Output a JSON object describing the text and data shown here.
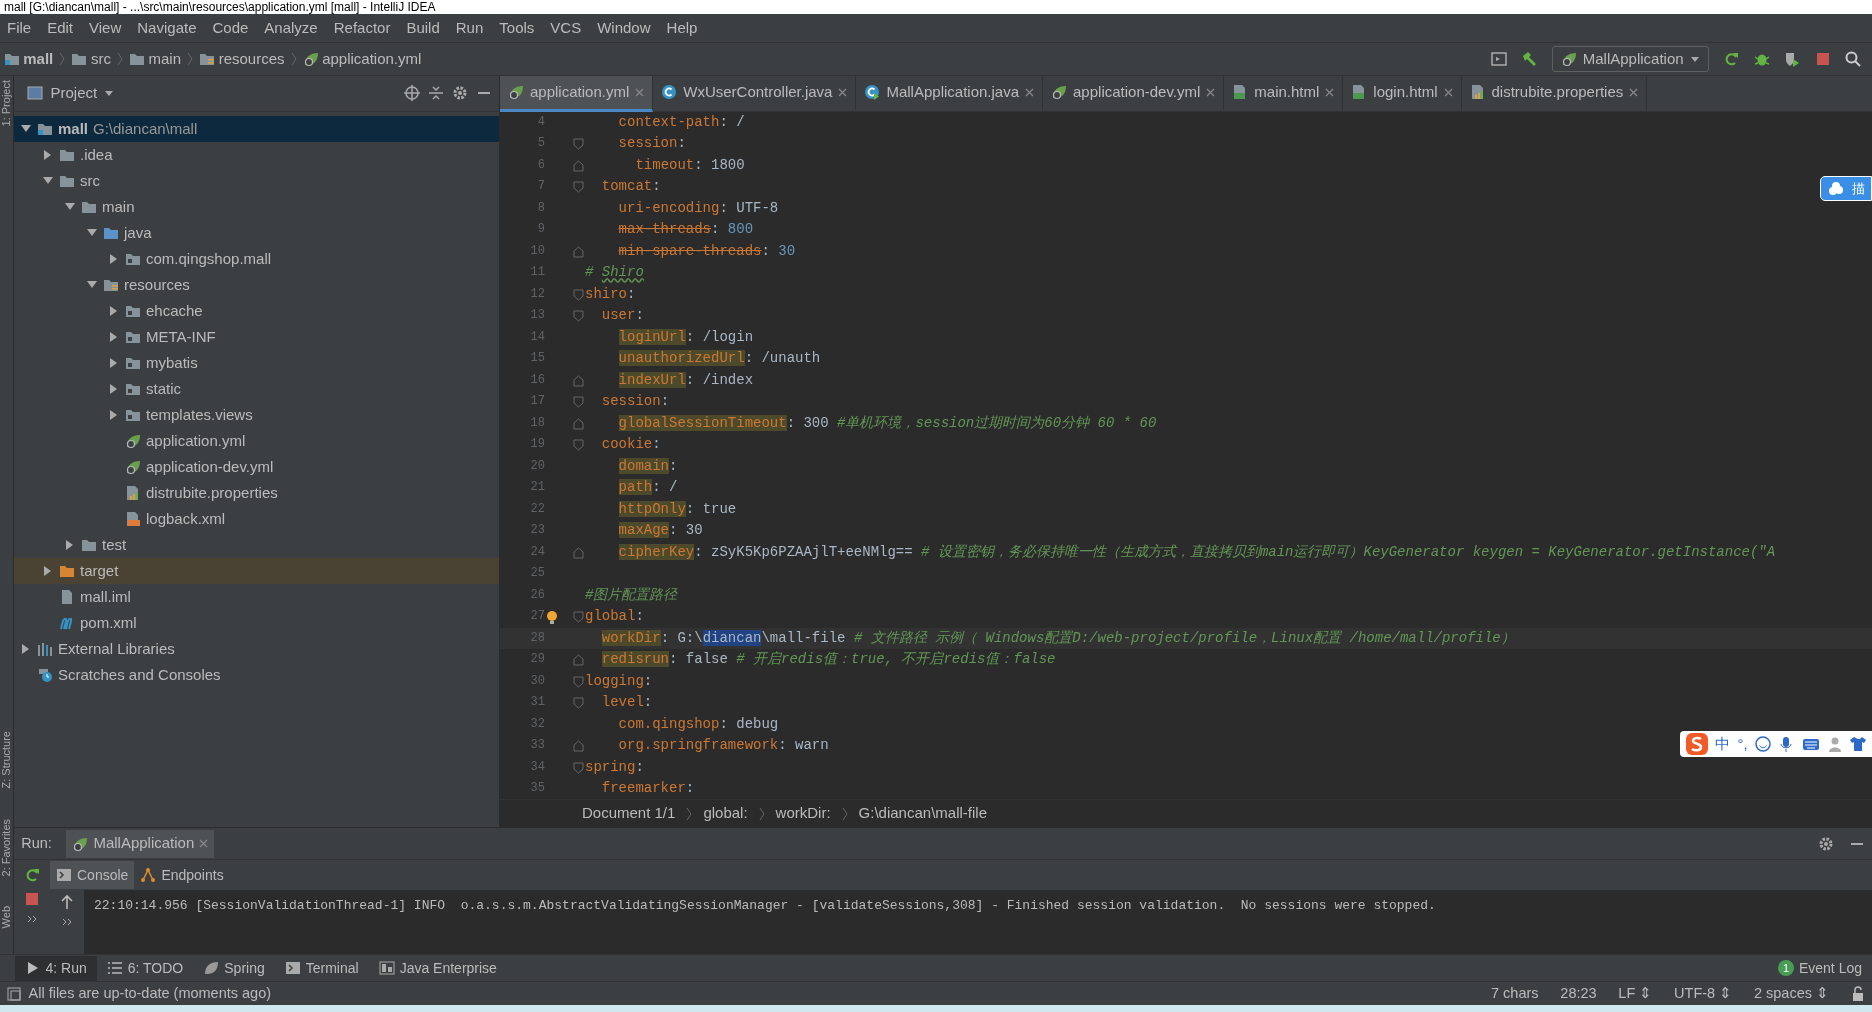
{
  "window": {
    "title": "mall [G:\\diancan\\mall] - ...\\src\\main\\resources\\application.yml [mall] - IntelliJ IDEA"
  },
  "menu": [
    "File",
    "Edit",
    "View",
    "Navigate",
    "Code",
    "Analyze",
    "Refactor",
    "Build",
    "Run",
    "Tools",
    "VCS",
    "Window",
    "Help"
  ],
  "nav_path": [
    {
      "label": "mall",
      "kind": "module"
    },
    {
      "label": "src",
      "kind": "folder"
    },
    {
      "label": "main",
      "kind": "folder"
    },
    {
      "label": "resources",
      "kind": "resources"
    },
    {
      "label": "application.yml",
      "kind": "spring"
    }
  ],
  "run_config": {
    "label": "MallApplication"
  },
  "side_strip": [
    "1: Project",
    "Z: Structure",
    "2: Favorites",
    "Web"
  ],
  "project_panel": {
    "title": "Project"
  },
  "tree": [
    {
      "name": "mall",
      "path": "G:\\diancan\\mall",
      "kind": "module",
      "expanded": true,
      "selected": true,
      "children": [
        {
          "name": ".idea",
          "kind": "folder",
          "expanded": false,
          "selected": false
        },
        {
          "name": "src",
          "kind": "folder",
          "expanded": true,
          "selected": false,
          "children": [
            {
              "name": "main",
              "kind": "folder",
              "expanded": true,
              "selected": false,
              "children": [
                {
                  "name": "java",
                  "kind": "source",
                  "expanded": true,
                  "selected": false,
                  "children": [
                    {
                      "name": "com.qingshop.mall",
                      "kind": "package",
                      "expanded": false,
                      "selected": false
                    }
                  ]
                },
                {
                  "name": "resources",
                  "kind": "resources",
                  "expanded": true,
                  "selected": false,
                  "children": [
                    {
                      "name": "ehcache",
                      "kind": "package",
                      "expanded": false,
                      "selected": false
                    },
                    {
                      "name": "META-INF",
                      "kind": "package",
                      "expanded": false,
                      "selected": false
                    },
                    {
                      "name": "mybatis",
                      "kind": "package",
                      "expanded": false,
                      "selected": false
                    },
                    {
                      "name": "static",
                      "kind": "package",
                      "expanded": false,
                      "selected": false
                    },
                    {
                      "name": "templates.views",
                      "kind": "package",
                      "expanded": false,
                      "selected": false
                    },
                    {
                      "name": "application.yml",
                      "kind": "spring",
                      "selected": false
                    },
                    {
                      "name": "application-dev.yml",
                      "kind": "spring",
                      "selected": false
                    },
                    {
                      "name": "distrubite.properties",
                      "kind": "props",
                      "selected": false
                    },
                    {
                      "name": "logback.xml",
                      "kind": "xml",
                      "selected": false
                    }
                  ]
                }
              ]
            },
            {
              "name": "test",
              "kind": "folder",
              "expanded": false,
              "selected": false
            }
          ]
        },
        {
          "name": "target",
          "kind": "excluded",
          "expanded": false,
          "selected": false
        },
        {
          "name": "mall.iml",
          "kind": "iml",
          "selected": false
        },
        {
          "name": "pom.xml",
          "kind": "maven",
          "selected": false
        }
      ]
    },
    {
      "name": "External Libraries",
      "kind": "library",
      "expanded": false,
      "selected": false
    },
    {
      "name": "Scratches and Consoles",
      "kind": "scratches",
      "selected": false
    }
  ],
  "editor_tabs": [
    {
      "label": "application.yml",
      "kind": "spring",
      "selected": true
    },
    {
      "label": "WxUserController.java",
      "kind": "class",
      "selected": false
    },
    {
      "label": "MallApplication.java",
      "kind": "runclass",
      "selected": false
    },
    {
      "label": "application-dev.yml",
      "kind": "spring",
      "selected": false
    },
    {
      "label": "main.html",
      "kind": "html",
      "selected": false
    },
    {
      "label": "login.html",
      "kind": "html",
      "selected": false
    },
    {
      "label": "distrubite.properties",
      "kind": "props",
      "selected": false
    }
  ],
  "code_lines": [
    {
      "number": "4",
      "kind": "plain",
      "tokens": [
        {
          "kind": "key",
          "text": "    context-path"
        },
        {
          "kind": "plain",
          "text": ": /"
        }
      ]
    },
    {
      "number": "5",
      "kind": "fold_start",
      "tokens": [
        {
          "kind": "key",
          "text": "    session"
        },
        {
          "kind": "plain",
          "text": ":"
        }
      ]
    },
    {
      "number": "6",
      "kind": "fold_end",
      "tokens": [
        {
          "kind": "key",
          "text": "      timeout"
        },
        {
          "kind": "plain",
          "text": ": 1800"
        }
      ]
    },
    {
      "number": "7",
      "kind": "fold_start",
      "tokens": [
        {
          "kind": "key",
          "text": "  tomcat"
        },
        {
          "kind": "plain",
          "text": ":"
        }
      ]
    },
    {
      "number": "8",
      "kind": "plain",
      "tokens": [
        {
          "kind": "key",
          "text": "    uri-encoding"
        },
        {
          "kind": "plain",
          "text": ": UTF-8"
        }
      ]
    },
    {
      "number": "9",
      "kind": "plain",
      "tokens": [
        {
          "kind": "strike",
          "text": "    max-threads"
        },
        {
          "kind": "plain",
          "text": ": "
        },
        {
          "kind": "num",
          "text": "800"
        }
      ]
    },
    {
      "number": "10",
      "kind": "fold_end",
      "tokens": [
        {
          "kind": "strike",
          "text": "    min-spare-threads"
        },
        {
          "kind": "plain",
          "text": ": "
        },
        {
          "kind": "num",
          "text": "30"
        }
      ]
    },
    {
      "number": "11",
      "kind": "plain",
      "tokens": [
        {
          "kind": "comment",
          "text": "# "
        },
        {
          "kind": "typo",
          "text": "Shiro"
        }
      ]
    },
    {
      "number": "12",
      "kind": "fold_start",
      "tokens": [
        {
          "kind": "key",
          "text": "shiro"
        },
        {
          "kind": "plain",
          "text": ":"
        }
      ]
    },
    {
      "number": "13",
      "kind": "fold_start",
      "tokens": [
        {
          "kind": "key",
          "text": "  user"
        },
        {
          "kind": "plain",
          "text": ":"
        }
      ]
    },
    {
      "number": "14",
      "kind": "plain",
      "tokens": [
        {
          "kind": "keyhl",
          "text": "    loginUrl"
        },
        {
          "kind": "plain",
          "text": ": /login"
        }
      ]
    },
    {
      "number": "15",
      "kind": "plain",
      "tokens": [
        {
          "kind": "keyhl",
          "text": "    unauthorizedUrl"
        },
        {
          "kind": "plain",
          "text": ": /unauth"
        }
      ]
    },
    {
      "number": "16",
      "kind": "fold_end",
      "tokens": [
        {
          "kind": "keyhl",
          "text": "    indexUrl"
        },
        {
          "kind": "plain",
          "text": ": /index"
        }
      ]
    },
    {
      "number": "17",
      "kind": "fold_start",
      "tokens": [
        {
          "kind": "key",
          "text": "  session"
        },
        {
          "kind": "plain",
          "text": ":"
        }
      ]
    },
    {
      "number": "18",
      "kind": "fold_end",
      "tokens": [
        {
          "kind": "keyhl",
          "text": "    globalSessionTimeout"
        },
        {
          "kind": "plain",
          "text": ": 300 "
        },
        {
          "kind": "comment",
          "text": "#单机环境，session过期时间为60分钟 60 * 60"
        }
      ]
    },
    {
      "number": "19",
      "kind": "fold_start",
      "tokens": [
        {
          "kind": "key",
          "text": "  cookie"
        },
        {
          "kind": "plain",
          "text": ":"
        }
      ]
    },
    {
      "number": "20",
      "kind": "plain",
      "tokens": [
        {
          "kind": "keyhl",
          "text": "    domain"
        },
        {
          "kind": "plain",
          "text": ":"
        }
      ]
    },
    {
      "number": "21",
      "kind": "plain",
      "tokens": [
        {
          "kind": "keyhl",
          "text": "    path"
        },
        {
          "kind": "plain",
          "text": ": /"
        }
      ]
    },
    {
      "number": "22",
      "kind": "plain",
      "tokens": [
        {
          "kind": "keyhl",
          "text": "    httpOnly"
        },
        {
          "kind": "plain",
          "text": ": true"
        }
      ]
    },
    {
      "number": "23",
      "kind": "plain",
      "tokens": [
        {
          "kind": "keyhl",
          "text": "    maxAge"
        },
        {
          "kind": "plain",
          "text": ": 30"
        }
      ]
    },
    {
      "number": "24",
      "kind": "fold_end",
      "tokens": [
        {
          "kind": "keyhl",
          "text": "    cipherKey"
        },
        {
          "kind": "plain",
          "text": ": zSyK5Kp6PZAAjlT+eeNMlg== "
        },
        {
          "kind": "comment",
          "text": "# 设置密钥，务必保持唯一性（生成方式，直接拷贝到main运行即可）KeyGenerator keygen = KeyGenerator.getInstance(\"A"
        }
      ]
    },
    {
      "number": "25",
      "kind": "plain"
    },
    {
      "number": "26",
      "kind": "plain",
      "tokens": [
        {
          "kind": "comment",
          "text": "#图片配置路径"
        }
      ]
    },
    {
      "number": "27",
      "kind": "fold_start",
      "bulb": true,
      "tokens": [
        {
          "kind": "key",
          "text": "global"
        },
        {
          "kind": "plain",
          "text": ":"
        }
      ]
    },
    {
      "number": "28",
      "kind": "plain",
      "current": true,
      "tokens": [
        {
          "kind": "keyhl",
          "text": "  workDir"
        },
        {
          "kind": "plain",
          "text": ": G:\\"
        },
        {
          "kind": "sel",
          "text": "diancan"
        },
        {
          "kind": "plain",
          "text": "\\mall-file "
        },
        {
          "kind": "comment",
          "text": "# 文件路径 示例（ Windows配置D:/web-project/profile，Linux配置 /home/mall/profile）"
        }
      ]
    },
    {
      "number": "29",
      "kind": "fold_end",
      "tokens": [
        {
          "kind": "keyhl",
          "text": "  redisrun"
        },
        {
          "kind": "plain",
          "text": ": false "
        },
        {
          "kind": "comment",
          "text": "# 开启redis值：true, 不开启redis值：false"
        }
      ]
    },
    {
      "number": "30",
      "kind": "fold_start",
      "tokens": [
        {
          "kind": "key",
          "text": "logging"
        },
        {
          "kind": "plain",
          "text": ":"
        }
      ]
    },
    {
      "number": "31",
      "kind": "fold_start",
      "tokens": [
        {
          "kind": "key",
          "text": "  level"
        },
        {
          "kind": "plain",
          "text": ":"
        }
      ]
    },
    {
      "number": "32",
      "kind": "plain",
      "tokens": [
        {
          "kind": "key",
          "text": "    com.qingshop"
        },
        {
          "kind": "plain",
          "text": ": debug"
        }
      ]
    },
    {
      "number": "33",
      "kind": "fold_end",
      "tokens": [
        {
          "kind": "key",
          "text": "    org.springframework"
        },
        {
          "kind": "plain",
          "text": ": warn"
        }
      ]
    },
    {
      "number": "34",
      "kind": "fold_start",
      "tokens": [
        {
          "kind": "key",
          "text": "spring"
        },
        {
          "kind": "plain",
          "text": ":"
        }
      ]
    },
    {
      "number": "35",
      "kind": "plain",
      "tokens": [
        {
          "kind": "key",
          "text": "  freemarker"
        },
        {
          "kind": "plain",
          "text": ":"
        }
      ]
    }
  ],
  "editor_breadcrumb": [
    "Document 1/1",
    "global:",
    "workDir:",
    "G:\\diancan\\mall-file"
  ],
  "baidu_widget": {
    "label": "描"
  },
  "ime_toolbar": {
    "mode": "中",
    "punctuation": "°,"
  },
  "run_panel": {
    "label": "Run:",
    "tab": "MallApplication",
    "console_tabs": [
      {
        "label": "Console",
        "kind": "console",
        "selected": true
      },
      {
        "label": "Endpoints",
        "kind": "endpoints",
        "selected": false
      }
    ],
    "output": "22:10:14.956 [SessionValidationThread-1] INFO  o.a.s.s.m.AbstractValidatingSessionManager - [validateSessions,308] - Finished session validation.  No sessions were stopped."
  },
  "tool_windows": [
    {
      "label": "4: Run",
      "kind": "run",
      "selected": true
    },
    {
      "label": "6: TODO",
      "kind": "todo",
      "selected": false
    },
    {
      "label": "Spring",
      "kind": "spring",
      "selected": false
    },
    {
      "label": "Terminal",
      "kind": "terminal",
      "selected": false
    },
    {
      "label": "Java Enterprise",
      "kind": "javaee",
      "selected": false
    }
  ],
  "event_log": {
    "label": "Event Log",
    "count": "1"
  },
  "status_bar": {
    "message": "All files are up-to-date (moments ago)",
    "items": [
      "7 chars",
      "28:23",
      "LF ⇕",
      "UTF-8 ⇕",
      "2 spaces ⇕"
    ]
  }
}
